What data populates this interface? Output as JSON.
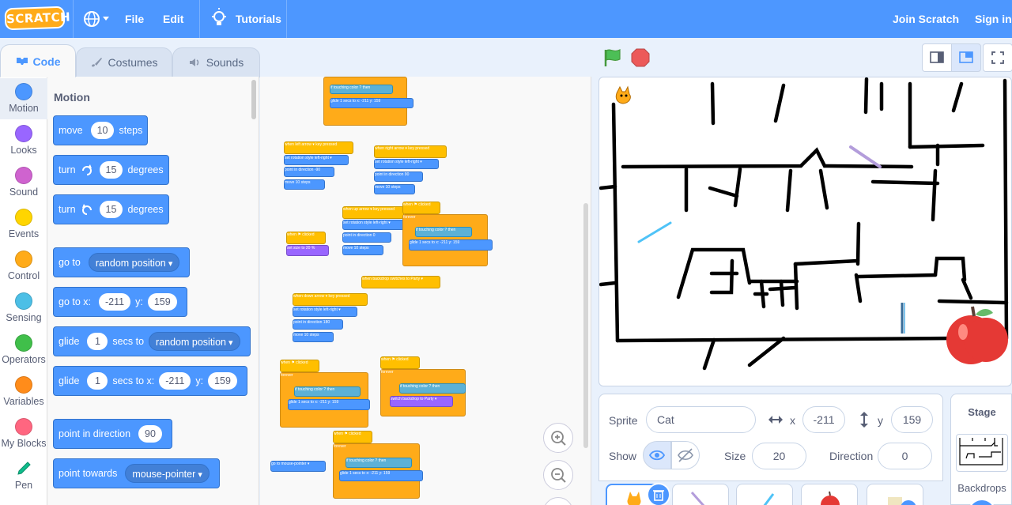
{
  "menu": {
    "logo": "SCRATCH",
    "file": "File",
    "edit": "Edit",
    "tutorials": "Tutorials",
    "join": "Join Scratch",
    "signin": "Sign in"
  },
  "tabs": {
    "code": "Code",
    "costumes": "Costumes",
    "sounds": "Sounds"
  },
  "categories": [
    {
      "label": "Motion",
      "color": "#4c97ff"
    },
    {
      "label": "Looks",
      "color": "#9966ff"
    },
    {
      "label": "Sound",
      "color": "#cf63cf"
    },
    {
      "label": "Events",
      "color": "#ffd500"
    },
    {
      "label": "Control",
      "color": "#ffab19"
    },
    {
      "label": "Sensing",
      "color": "#4cbfe6"
    },
    {
      "label": "Operators",
      "color": "#40bf4a"
    },
    {
      "label": "Variables",
      "color": "#ff8c1a"
    },
    {
      "label": "My Blocks",
      "color": "#ff6680"
    },
    {
      "label": "Pen",
      "color": "#0fbd8c"
    }
  ],
  "palette": {
    "title": "Motion",
    "move": {
      "a": "move",
      "v": "10",
      "b": "steps"
    },
    "turn_right": {
      "a": "turn",
      "v": "15",
      "b": "degrees"
    },
    "turn_left": {
      "a": "turn",
      "v": "15",
      "b": "degrees"
    },
    "goto": {
      "a": "go to",
      "dd": "random position"
    },
    "goto_xy": {
      "a": "go to x:",
      "x": "-211",
      "b": "y:",
      "y": "159"
    },
    "glide": {
      "a": "glide",
      "v": "1",
      "b": "secs to",
      "dd": "random position"
    },
    "glide_xy": {
      "a": "glide",
      "v": "1",
      "b": "secs to x:",
      "x": "-211",
      "c": "y:",
      "y": "159"
    },
    "point_dir": {
      "a": "point in direction",
      "v": "90"
    },
    "point_towards": {
      "a": "point towards",
      "dd": "mouse-pointer"
    }
  },
  "scripts": {
    "when_left": "when left arrow ▾ key pressed",
    "when_right": "when right arrow ▾ key pressed",
    "when_up": "when up arrow ▾ key pressed",
    "when_down": "when down arrow ▾ key pressed",
    "rot_style": "set rotation style left-right ▾",
    "point_m90": "point in direction -90",
    "point_90": "point in direction 90",
    "point_0": "point in direction 0",
    "point_180": "point in direction 180",
    "move10": "move 10 steps",
    "when_flag": "when ⚑ clicked",
    "forever": "forever",
    "if_touch": "if touching color ? then",
    "glide_xy": "glide 1 secs to x: -211 y: 159",
    "set_size": "set size to 20 %",
    "when_backdrop": "when backdrop switches to Party ▾",
    "switch_backdrop": "switch backdrop to Party ▾",
    "goto_mouse": "go to mouse-pointer ▾"
  },
  "sprite": {
    "label": "Sprite",
    "name": "Cat",
    "x_label": "x",
    "x": "-211",
    "y_label": "y",
    "y": "159",
    "show_label": "Show",
    "size_label": "Size",
    "size": "20",
    "direction_label": "Direction",
    "direction": "0"
  },
  "stage_pane": {
    "title": "Stage",
    "backdrops": "Backdrops"
  }
}
